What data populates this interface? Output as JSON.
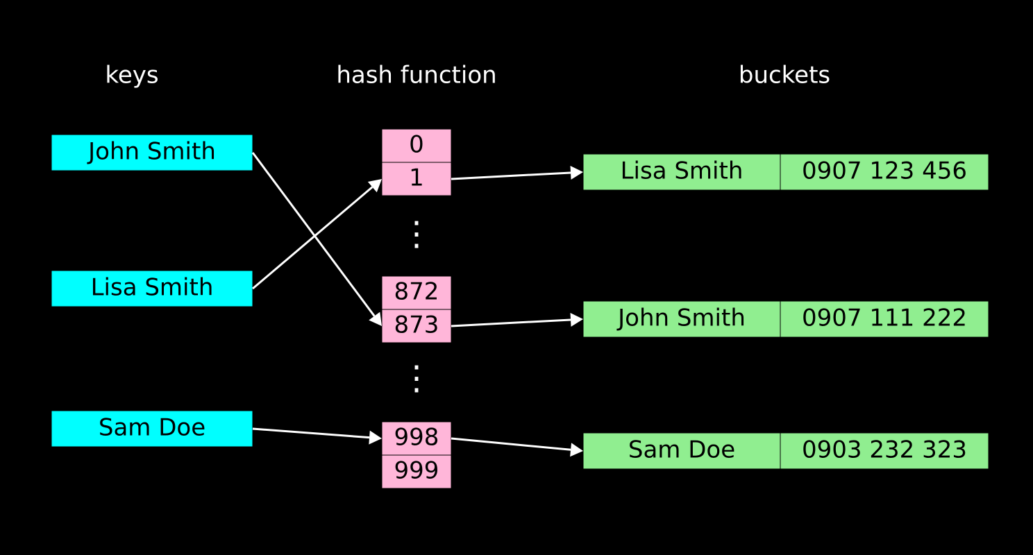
{
  "headings": {
    "keys": "keys",
    "hash": "hash function",
    "buckets": "buckets"
  },
  "keys": [
    "John Smith",
    "Lisa Smith",
    "Sam Doe"
  ],
  "hash_slots": [
    [
      "0",
      "1"
    ],
    [
      "872",
      "873"
    ],
    [
      "998",
      "999"
    ]
  ],
  "buckets": [
    {
      "name": "Lisa Smith",
      "value": "0907 123 456"
    },
    {
      "name": "John Smith",
      "value": "0907 111 222"
    },
    {
      "name": "Sam Doe",
      "value": "0903 232 323"
    }
  ],
  "ellipsis": "⋮"
}
